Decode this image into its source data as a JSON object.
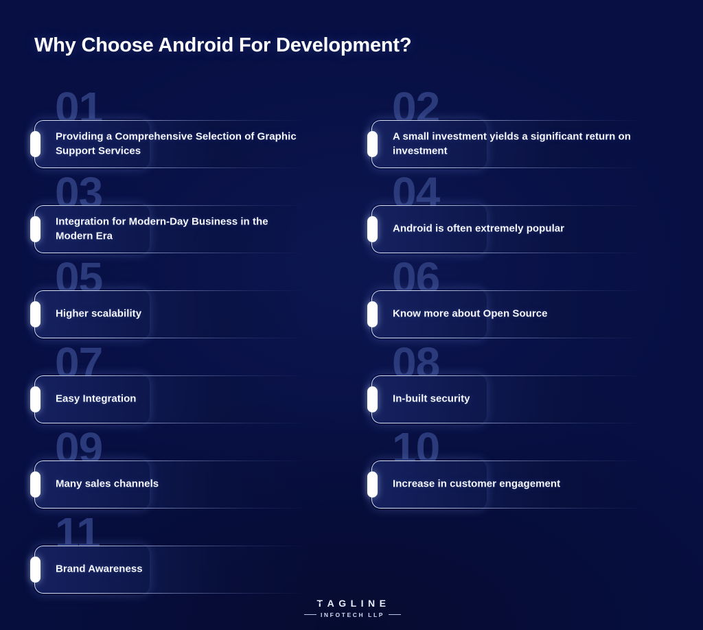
{
  "page": {
    "background_color": "#070f43",
    "title": "Why Choose Android For Development?"
  },
  "theme": {
    "background": "#070f43",
    "card_fill": "#162260",
    "card_border": "#ecf2ff",
    "ghost_number": "#2b3a7a",
    "text": "#f4f7ff",
    "marker": "#ffffff"
  },
  "cards": [
    {
      "number": "01",
      "text": "Providing a Comprehensive Selection of Graphic Support Services"
    },
    {
      "number": "02",
      "text": "A small investment yields a significant return on investment"
    },
    {
      "number": "03",
      "text": "Integration for Modern-Day Business in the Modern Era"
    },
    {
      "number": "04",
      "text": "Android is often extremely popular"
    },
    {
      "number": "05",
      "text": "Higher scalability"
    },
    {
      "number": "06",
      "text": "Know more about Open Source"
    },
    {
      "number": "07",
      "text": "Easy Integration"
    },
    {
      "number": "08",
      "text": "In-built security"
    },
    {
      "number": "09",
      "text": "Many sales channels"
    },
    {
      "number": "10",
      "text": "Increase in customer engagement"
    },
    {
      "number": "11",
      "text": "Brand Awareness"
    }
  ],
  "footer": {
    "logo_name": "TAGLINE",
    "logo_name_letters": [
      "T",
      "A",
      "G",
      "L",
      "I",
      "N",
      "E"
    ],
    "logo_tagline": "INFOTECH LLP"
  }
}
